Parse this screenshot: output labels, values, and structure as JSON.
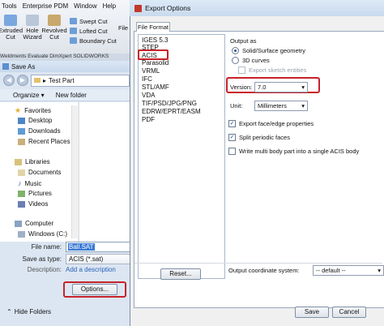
{
  "ribbon": {
    "menu": [
      "Tools",
      "Enterprise PDM",
      "Window",
      "Help"
    ],
    "big_buttons": [
      "Extruded Cut",
      "Hole Wizard",
      "Revolved Cut"
    ],
    "small_commands": [
      "Swept Cut",
      "Lofted Cut",
      "Boundary Cut"
    ],
    "extra_label": "File",
    "tabstrip": "Weldments   Evaluate   DimXpert   SOLIDWORKS"
  },
  "save_as": {
    "title": "Save As",
    "address": "Test Part",
    "organize": "Organize ▾",
    "new_folder": "New folder",
    "nav": {
      "favorites": "Favorites",
      "desktop": "Desktop",
      "downloads": "Downloads",
      "recent": "Recent Places",
      "libraries": "Libraries",
      "documents": "Documents",
      "music": "Music",
      "pictures": "Pictures",
      "videos": "Videos",
      "computer": "Computer",
      "windows_c": "Windows (C:)"
    },
    "file_name_label": "File name:",
    "file_name_value": "Ball.SAT",
    "save_type_label": "Save as type:",
    "save_type_value": "ACIS (*.sat)",
    "description_label": "Description:",
    "description_value": "Add a description",
    "options_button": "Options...",
    "hide_folders": "Hide Folders"
  },
  "export": {
    "title": "Export Options",
    "tab": "File Format",
    "formats": [
      "IGES 5.3",
      "STEP",
      "ACIS",
      "Parasolid",
      "VRML",
      "IFC",
      "STL/AMF",
      "VDA",
      "TIF/PSD/JPG/PNG",
      "EDRW/EPRT/EASM",
      "PDF"
    ],
    "reset": "Reset...",
    "output_as": "Output as",
    "solid": "Solid/Surface geometry",
    "curves": "3D curves",
    "sketch": "Export sketch entities",
    "version_label": "Version:",
    "version_value": "7.0",
    "unit_label": "Unit:",
    "unit_value": "Millimeters",
    "face_edge": "Export face/edge properties",
    "split": "Split periodic faces",
    "multi_body": "Write multi body part into a single ACIS body",
    "coord_label": "Output coordinate system:",
    "coord_value": "-- default --",
    "save": "Save",
    "cancel": "Cancel"
  }
}
